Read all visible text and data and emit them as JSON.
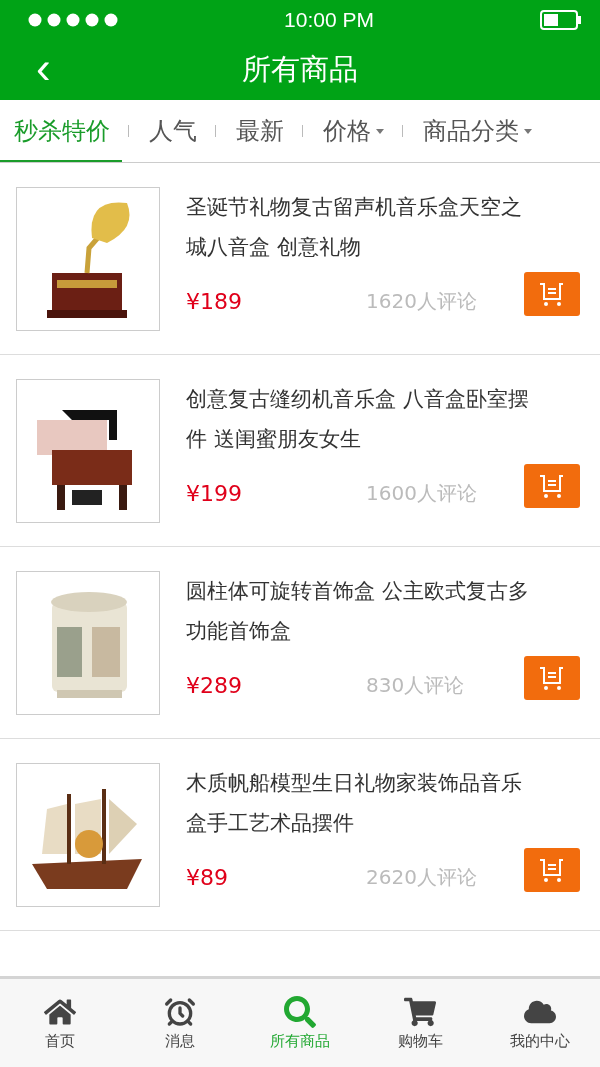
{
  "status_bar": {
    "time": "10:00 PM"
  },
  "header": {
    "back": "‹",
    "title": "所有商品"
  },
  "filters": [
    {
      "label": "秒杀特价",
      "selected": true,
      "dropdown": false
    },
    {
      "label": "人气",
      "selected": false,
      "dropdown": false
    },
    {
      "label": "最新",
      "selected": false,
      "dropdown": false
    },
    {
      "label": "价格",
      "selected": false,
      "dropdown": true
    },
    {
      "label": "商品分类",
      "selected": false,
      "dropdown": true
    }
  ],
  "products": [
    {
      "title": "圣诞节礼物复古留声机音乐盒天空之城八音盒 创意礼物",
      "price": "¥189",
      "reviews": "1620人评论"
    },
    {
      "title": "创意复古缝纫机音乐盒 八音盒卧室摆件 送闺蜜朋友女生",
      "price": "¥199",
      "reviews": "1600人评论"
    },
    {
      "title": "圆柱体可旋转首饰盒 公主欧式复古多功能首饰盒",
      "price": "¥289",
      "reviews": "830人评论"
    },
    {
      "title": "木质帆船模型生日礼物家装饰品音乐盒手工艺术品摆件",
      "price": "¥89",
      "reviews": "2620人评论"
    }
  ],
  "tab_bar": [
    {
      "label": "首页",
      "selected": false
    },
    {
      "label": "消息",
      "selected": false
    },
    {
      "label": "所有商品",
      "selected": true
    },
    {
      "label": "购物车",
      "selected": false
    },
    {
      "label": "我的中心",
      "selected": false
    }
  ]
}
